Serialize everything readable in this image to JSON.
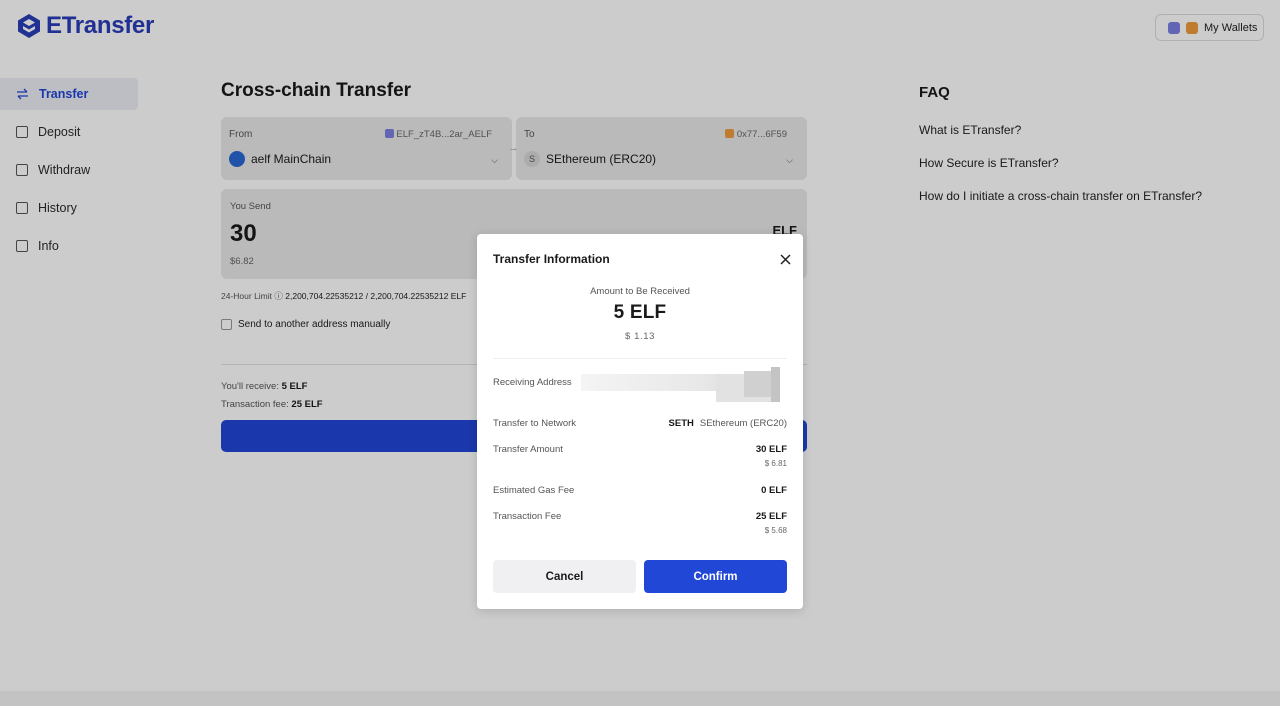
{
  "app": {
    "logo_text": "ETransfer",
    "wallet_button": "My Wallets"
  },
  "sidebar": {
    "items": [
      {
        "label": "Transfer"
      },
      {
        "label": "Deposit"
      },
      {
        "label": "Withdraw"
      },
      {
        "label": "History"
      },
      {
        "label": "Info"
      }
    ]
  },
  "main": {
    "title": "Cross-chain Transfer",
    "from": {
      "label": "From",
      "address": "ELF_zT4B...2ar_AELF",
      "chain": "aelf MainChain"
    },
    "to": {
      "label": "To",
      "address": "0x77...6F59",
      "chain_letter": "S",
      "chain": "SEthereum (ERC20)"
    },
    "send": {
      "label": "You Send",
      "amount": "30",
      "usd": "$6.82",
      "token": "ELF"
    },
    "limit": {
      "label": "24-Hour Limit",
      "value": "2,200,704.22535212 / 2,200,704.22535212",
      "unit": "ELF"
    },
    "manual_address_label": "Send to another address manually",
    "receive_label": "You'll receive:",
    "receive_value": "5 ELF",
    "fee_label": "Transaction fee:",
    "fee_value": "25 ELF"
  },
  "faq": {
    "title": "FAQ",
    "items": [
      "What is ETransfer?",
      "How Secure is ETransfer?",
      "How do I initiate a cross-chain transfer on ETransfer?"
    ]
  },
  "modal": {
    "title": "Transfer Information",
    "receive_label": "Amount to Be Received",
    "receive_amount": "5 ELF",
    "receive_usd": "$ 1.13",
    "rows": {
      "receiving_address": {
        "label": "Receiving Address"
      },
      "network": {
        "label": "Transfer to Network",
        "code": "SETH",
        "name": "SEthereum (ERC20)"
      },
      "amount": {
        "label": "Transfer Amount",
        "value": "30 ELF",
        "usd": "$ 6.81"
      },
      "gas_fee": {
        "label": "Estimated Gas Fee",
        "value": "0 ELF"
      },
      "tx_fee": {
        "label": "Transaction Fee",
        "value": "25 ELF",
        "usd": "$ 5.68"
      }
    },
    "cancel_label": "Cancel",
    "confirm_label": "Confirm"
  },
  "colors": {
    "accent": "#2147d6",
    "logo": "#2a3db8",
    "panel_bg": "#e9e9ea",
    "overlay": "rgba(0,0,0,0.2)"
  }
}
